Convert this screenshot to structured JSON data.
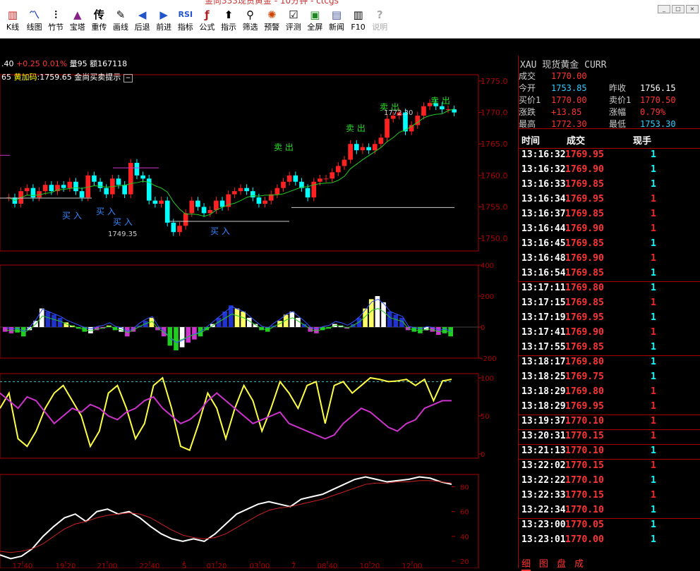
{
  "window": {
    "title": "金尚333现货黄金 - 10分钟 - ctcgs"
  },
  "toolbar": [
    {
      "icon": "kline-icon",
      "glyph": "▥",
      "label": "K线"
    },
    {
      "icon": "line-chart-icon",
      "glyph": "〽",
      "label": "线图"
    },
    {
      "icon": "bamboo-icon",
      "glyph": "⫶",
      "label": "竹节"
    },
    {
      "icon": "pagoda-icon",
      "glyph": "▲",
      "label": "宝塔"
    },
    {
      "icon": "chongchuan-icon",
      "glyph": "传",
      "label": "重传"
    },
    {
      "icon": "draw-line-icon",
      "glyph": "✎",
      "label": "画线"
    },
    {
      "icon": "back-icon",
      "glyph": "◀",
      "label": "后退"
    },
    {
      "icon": "forward-icon",
      "glyph": "▶",
      "label": "前进"
    },
    {
      "icon": "indicator-icon",
      "glyph": "RSI",
      "label": "指标"
    },
    {
      "icon": "formula-icon",
      "glyph": "ƒ",
      "label": "公式"
    },
    {
      "icon": "indicate-icon",
      "glyph": "⬆",
      "label": "指示"
    },
    {
      "icon": "filter-icon",
      "glyph": "⚲",
      "label": "筛选"
    },
    {
      "icon": "alert-icon",
      "glyph": "✺",
      "label": "预警"
    },
    {
      "icon": "review-icon",
      "glyph": "☑",
      "label": "评测"
    },
    {
      "icon": "fullscreen-icon",
      "glyph": "▣",
      "label": "全屏"
    },
    {
      "icon": "news-icon",
      "glyph": "▤",
      "label": "新闻"
    },
    {
      "icon": "f10-icon",
      "glyph": "▥",
      "label": "F10"
    },
    {
      "icon": "help-icon",
      "glyph": "?",
      "label": "说明"
    }
  ],
  "infobar": {
    "price_left": ".40",
    "change": "+0.25",
    "pct": "0.01%",
    "volume": "量95",
    "amount": "额167118"
  },
  "main_chart_label": {
    "ma_value": "65",
    "yellow_label": "黄加码",
    "yellow_value": ":1759.65",
    "signal_label": "金尚买卖提示"
  },
  "colors": {
    "up": "#ff2222",
    "down": "#00ffff",
    "accent": "#ff0000",
    "yellow": "#ffff00",
    "green": "#00cc00",
    "magenta": "#cc33cc"
  },
  "chart_data": [
    {
      "type": "candlestick",
      "ylim": [
        1748,
        1776
      ],
      "y_ticks": [
        "1775.0",
        "1770.0",
        "1765.0",
        "1760.0",
        "1755.0",
        "1750.0"
      ],
      "annotations": [
        {
          "text": "卖  出",
          "x_time": "12:00",
          "y": 1771.5
        },
        {
          "text": "卖  出",
          "x_time": "10:20",
          "y": 1771.5
        },
        {
          "text": "卖  出",
          "x_time": "08:40",
          "y": 1768
        },
        {
          "text": "卖  出",
          "x_time": "03:00",
          "y": 1766
        },
        {
          "text": "买  入",
          "x_time": "19:20",
          "y": 1753.5
        },
        {
          "text": "买  入",
          "x_time": "21:00",
          "y": 1754
        },
        {
          "text": "买  入",
          "x_time": "21:00",
          "y": 1752
        },
        {
          "text": "买  入",
          "x_time": "01:20",
          "y": 1750
        },
        {
          "text": "1772.30",
          "x_time": "10:20",
          "y": 1771
        },
        {
          "text": "1749.35",
          "x_time": "21:00",
          "y": 1749.4
        }
      ],
      "series": [
        {
          "values": [
            1756.5,
            1755.5,
            1757.5,
            1758.0,
            1756.5,
            1757.5,
            1758.5,
            1757.5,
            1758.5,
            1758.0,
            1759.0,
            1757.5,
            1756.5,
            1760.0,
            1759.0,
            1758.0,
            1757.0,
            1759.5,
            1758.5,
            1757.0,
            1762.0,
            1760.0,
            1759.5,
            1756.0,
            1755.5,
            1756.0,
            1752.5,
            1751.0,
            1752.0,
            1754.0,
            1756.0,
            1755.0,
            1754.0,
            1754.5,
            1756.0,
            1755.0,
            1757.0,
            1757.5,
            1758.0,
            1757.5,
            1756.5,
            1755.5,
            1756.0,
            1757.0,
            1758.0,
            1759.0,
            1760.0,
            1759.0,
            1758.0,
            1756.5,
            1759.0,
            1759.5,
            1759.5,
            1760.5,
            1761.5,
            1762.5,
            1765.0,
            1764.0,
            1764.5,
            1764.0,
            1765.0,
            1766.0,
            1769.0,
            1769.5,
            1770.0,
            1767.0,
            1768.0,
            1769.5,
            1771.0,
            1771.5,
            1771.0,
            1770.5,
            1770.5,
            1770.0
          ]
        }
      ]
    },
    {
      "type": "bar",
      "ylim": [
        -200,
        400
      ],
      "y_ticks": [
        "400",
        "200",
        "0",
        "-200"
      ],
      "series": [
        {
          "values": [
            -30,
            -40,
            -35,
            -60,
            -20,
            40,
            120,
            100,
            80,
            60,
            30,
            10,
            -10,
            -30,
            -40,
            -20,
            -10,
            10,
            -20,
            -30,
            -60,
            -30,
            10,
            40,
            60,
            -20,
            -60,
            -120,
            -150,
            -130,
            -100,
            -80,
            -60,
            -20,
            20,
            60,
            100,
            140,
            120,
            100,
            60,
            20,
            -20,
            -30,
            10,
            40,
            80,
            100,
            60,
            20,
            -30,
            -40,
            -20,
            -10,
            20,
            10,
            -10,
            20,
            60,
            120,
            180,
            200,
            160,
            100,
            80,
            60,
            -20,
            -30,
            -40,
            -20,
            -30,
            -50,
            -40,
            -60
          ]
        }
      ]
    },
    {
      "type": "line",
      "ylim": [
        0,
        100
      ],
      "y_ticks": [
        "100",
        "50",
        "0"
      ],
      "series": [
        {
          "values": [
            60,
            80,
            20,
            10,
            30,
            60,
            80,
            90,
            70,
            50,
            10,
            30,
            80,
            90,
            60,
            20,
            40,
            90,
            100,
            60,
            10,
            5,
            40,
            80,
            60,
            20,
            60,
            90,
            70,
            30,
            60,
            95,
            80,
            60,
            90,
            95,
            40,
            90,
            95,
            80,
            90,
            100,
            98,
            95,
            96,
            98,
            90,
            98,
            70,
            96,
            98
          ]
        },
        {
          "values": [
            80,
            70,
            60,
            75,
            70,
            55,
            40,
            50,
            60,
            55,
            65,
            60,
            50,
            45,
            55,
            60,
            70,
            75,
            60,
            50,
            40,
            45,
            55,
            70,
            80,
            70,
            60,
            50,
            40,
            45,
            50,
            55,
            40,
            35,
            30,
            25,
            20,
            25,
            40,
            50,
            60,
            55,
            45,
            35,
            30,
            40,
            45,
            60,
            65,
            70,
            70
          ]
        }
      ]
    },
    {
      "type": "line",
      "ylim": [
        20,
        90
      ],
      "y_ticks": [
        "80",
        "60",
        "40",
        "20"
      ],
      "x_ticks": [
        "17:40",
        "19:20",
        "21:00",
        "22:40",
        "5",
        "01:20",
        "03:00",
        "7",
        "08:40",
        "10:20",
        "12:00"
      ],
      "series": [
        {
          "values": [
            25,
            22,
            24,
            30,
            40,
            48,
            55,
            58,
            52,
            60,
            62,
            58,
            60,
            55,
            48,
            42,
            38,
            36,
            38,
            36,
            42,
            50,
            58,
            62,
            66,
            68,
            66,
            64,
            70,
            72,
            74,
            78,
            82,
            86,
            88,
            86,
            84,
            85,
            86,
            88,
            87,
            84,
            82
          ]
        },
        {
          "values": [
            28,
            27,
            28,
            30,
            34,
            40,
            46,
            50,
            52,
            55,
            57,
            58,
            59,
            58,
            55,
            50,
            45,
            41,
            39,
            38,
            39,
            42,
            47,
            52,
            57,
            61,
            63,
            64,
            66,
            68,
            70,
            73,
            76,
            79,
            82,
            83,
            83,
            84,
            84,
            85,
            85,
            84,
            83
          ]
        }
      ]
    }
  ],
  "quote": {
    "header": "XAU 现货黄金    CURR",
    "rows": [
      {
        "k": "成交",
        "v": "1770.00",
        "k2": "",
        "v2": ""
      },
      {
        "k": "今开",
        "v": "1753.85",
        "k2": "昨收",
        "v2": "1756.15"
      },
      {
        "k": "买价1",
        "v": "1770.00",
        "k2": "卖价1",
        "v2": "1770.50"
      },
      {
        "k": "涨跌",
        "v": "+13.85",
        "k2": "涨幅",
        "v2": "0.79%"
      },
      {
        "k": "最高",
        "v": "1772.30",
        "k2": "最低",
        "v2": "1753.30"
      }
    ]
  },
  "trades_header": {
    "time": "时间",
    "price": "成交",
    "vol": "现手"
  },
  "trades": [
    {
      "time": "13:16:32",
      "price": "1769.95",
      "vol": "1",
      "dir": "down"
    },
    {
      "time": "13:16:32",
      "price": "1769.90",
      "vol": "1",
      "dir": "down"
    },
    {
      "time": "13:16:33",
      "price": "1769.85",
      "vol": "1",
      "dir": "down"
    },
    {
      "time": "13:16:34",
      "price": "1769.95",
      "vol": "1",
      "dir": "up"
    },
    {
      "time": "13:16:37",
      "price": "1769.85",
      "vol": "1",
      "dir": "up"
    },
    {
      "time": "13:16:44",
      "price": "1769.90",
      "vol": "1",
      "dir": "up"
    },
    {
      "time": "13:16:45",
      "price": "1769.85",
      "vol": "1",
      "dir": "down"
    },
    {
      "time": "13:16:48",
      "price": "1769.90",
      "vol": "1",
      "dir": "up"
    },
    {
      "time": "13:16:54",
      "price": "1769.85",
      "vol": "1",
      "dir": "down"
    },
    {
      "time": "13:17:11",
      "price": "1769.80",
      "vol": "1",
      "dir": "down"
    },
    {
      "time": "13:17:15",
      "price": "1769.85",
      "vol": "1",
      "dir": "up"
    },
    {
      "time": "13:17:19",
      "price": "1769.95",
      "vol": "1",
      "dir": "down"
    },
    {
      "time": "13:17:41",
      "price": "1769.90",
      "vol": "1",
      "dir": "up"
    },
    {
      "time": "13:17:55",
      "price": "1769.85",
      "vol": "1",
      "dir": "down"
    },
    {
      "time": "13:18:17",
      "price": "1769.80",
      "vol": "1",
      "dir": "down"
    },
    {
      "time": "13:18:25",
      "price": "1769.75",
      "vol": "1",
      "dir": "down"
    },
    {
      "time": "13:18:29",
      "price": "1769.80",
      "vol": "1",
      "dir": "up"
    },
    {
      "time": "13:18:29",
      "price": "1769.95",
      "vol": "1",
      "dir": "up"
    },
    {
      "time": "13:19:37",
      "price": "1770.10",
      "vol": "1",
      "dir": "up"
    },
    {
      "time": "13:20:31",
      "price": "1770.15",
      "vol": "1",
      "dir": "up"
    },
    {
      "time": "13:21:13",
      "price": "1770.10",
      "vol": "1",
      "dir": "down"
    },
    {
      "time": "13:22:02",
      "price": "1770.15",
      "vol": "1",
      "dir": "up"
    },
    {
      "time": "13:22:22",
      "price": "1770.10",
      "vol": "1",
      "dir": "down"
    },
    {
      "time": "13:22:33",
      "price": "1770.15",
      "vol": "1",
      "dir": "up"
    },
    {
      "time": "13:22:34",
      "price": "1770.10",
      "vol": "1",
      "dir": "down"
    },
    {
      "time": "13:23:00",
      "price": "1770.05",
      "vol": "1",
      "dir": "down"
    },
    {
      "time": "13:23:01",
      "price": "1770.00",
      "vol": "1",
      "dir": "down"
    }
  ],
  "tabs": [
    "细",
    "图",
    "盘",
    "成"
  ]
}
